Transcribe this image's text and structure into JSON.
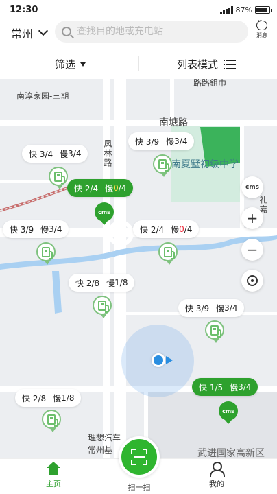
{
  "status_bar": {
    "time": "12:30",
    "battery": "87%"
  },
  "header": {
    "city": "常州",
    "search_placeholder": "查找目的地或充电站",
    "message_label": "消息"
  },
  "filter_row": {
    "filter_label": "筛选",
    "mode_label": "列表模式"
  },
  "map": {
    "labels": {
      "top_partial": "路路鉏巾",
      "community": "南淳家园-三期",
      "road_nantang": "南塘路",
      "road_fenglin": "凤林路",
      "school": "南夏墅初级中学",
      "road_right_partial": "礼嘉",
      "company": "理想汽车",
      "company2": "常州基",
      "district": "武进国家高新区"
    },
    "stations": [
      {
        "fast": "快 3/9",
        "slow_prefix": "慢 ",
        "slow_avail": "3",
        "slow_total": "/4"
      },
      {
        "fast": "快 3/4",
        "slow_prefix": "慢 ",
        "slow_avail": "3",
        "slow_total": "/4"
      },
      {
        "fast": "快 2/4",
        "slow_prefix": "慢 ",
        "slow_avail": "0",
        "slow_total": "/4"
      },
      {
        "fast": "快 3/9",
        "slow_prefix": "慢 ",
        "slow_avail": "3",
        "slow_total": "/4"
      },
      {
        "fast": "快 2/4",
        "slow_prefix": "慢 ",
        "slow_avail": "0",
        "slow_total": "/4"
      },
      {
        "fast": "快 2/8",
        "slow_prefix": "慢 ",
        "slow_avail": "1",
        "slow_total": "/8"
      },
      {
        "fast": "快 3/9",
        "slow_prefix": "慢 ",
        "slow_avail": "3",
        "slow_total": "/4"
      },
      {
        "fast": "快 1/5",
        "slow_prefix": "慢 ",
        "slow_avail": "3",
        "slow_total": "/4"
      },
      {
        "fast": "快 2/8",
        "slow_prefix": "慢 ",
        "slow_avail": "1",
        "slow_total": "/8"
      }
    ],
    "cms_label": "cms",
    "zoom_in": "+",
    "zoom_out": "−"
  },
  "bottom_nav": {
    "home": "主页",
    "scan": "扫一扫",
    "profile": "我的"
  },
  "colors": {
    "brand_green": "#2ea12e",
    "water": "#a9d0f2",
    "school_green": "#3bb35b",
    "unavailable_red": "#e23"
  }
}
